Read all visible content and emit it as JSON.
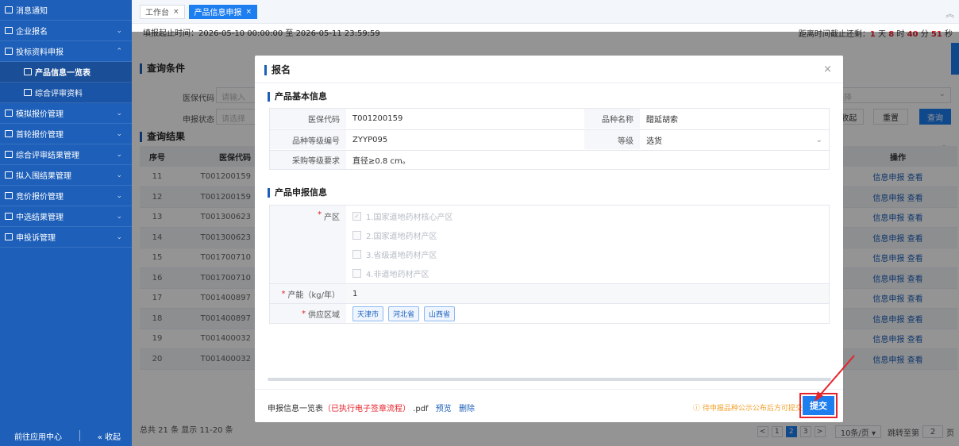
{
  "sidebar": {
    "items": [
      {
        "label": "消息通知",
        "chevron": ""
      },
      {
        "label": "企业报名",
        "chevron": "⌄"
      },
      {
        "label": "投标资料申报",
        "chevron": "⌃"
      },
      {
        "label": "产品信息一览表",
        "chevron": ""
      },
      {
        "label": "综合评审资料",
        "chevron": ""
      },
      {
        "label": "模拟报价管理",
        "chevron": "⌄"
      },
      {
        "label": "首轮报价管理",
        "chevron": "⌄"
      },
      {
        "label": "综合评审结果管理",
        "chevron": "⌄"
      },
      {
        "label": "拟入围结果管理",
        "chevron": "⌄"
      },
      {
        "label": "竞价报价管理",
        "chevron": "⌄"
      },
      {
        "label": "中选结果管理",
        "chevron": "⌄"
      },
      {
        "label": "申投诉管理",
        "chevron": "⌄"
      }
    ],
    "footer_left": "前往应用中心",
    "footer_right": "« 收起"
  },
  "tabs": [
    {
      "label": "工作台",
      "close": "×"
    },
    {
      "label": "产品信息申报",
      "close": "×"
    }
  ],
  "timebar": {
    "text": "填报起止时间：2026-05-10 00:00:00 至 2026-05-11 23:59:59",
    "countdown_prefix": "距离时间截止还剩：",
    "days": "1",
    "days_unit": "天",
    "hours": "8",
    "hours_unit": "时",
    "minutes": "40",
    "minutes_unit": "分",
    "seconds": "51",
    "seconds_unit": "秒"
  },
  "query": {
    "title": "查询条件",
    "code_label": "医保代码",
    "code_placeholder": "请输入",
    "status_label": "申报状态",
    "status_placeholder": "请选择",
    "right_placeholder": "选择",
    "collapse": "∧ 收起",
    "reset": "重置",
    "search": "查询"
  },
  "results": {
    "title": "查询结果",
    "headers": {
      "index": "序号",
      "code": "医保代码",
      "ops": "操作"
    },
    "rows": [
      {
        "index": "11",
        "code": "T001200159"
      },
      {
        "index": "12",
        "code": "T001200159"
      },
      {
        "index": "13",
        "code": "T001300623"
      },
      {
        "index": "14",
        "code": "T001300623"
      },
      {
        "index": "15",
        "code": "T001700710"
      },
      {
        "index": "16",
        "code": "T001700710"
      },
      {
        "index": "17",
        "code": "T001400897"
      },
      {
        "index": "18",
        "code": "T001400897"
      },
      {
        "index": "19",
        "code": "T001400032"
      },
      {
        "index": "20",
        "code": "T001400032"
      }
    ],
    "op1": "信息申报",
    "op2": "查看"
  },
  "footer": {
    "info": "总共 21 条 显示 11-20 条",
    "pages": [
      "1",
      "2",
      "3"
    ],
    "current_page": "2",
    "page_size": "10条/页 ▾",
    "jump_label": "跳转至第",
    "jump_value": "2",
    "jump_unit": "页"
  },
  "modal": {
    "title": "报名",
    "close": "×",
    "basic_title": "产品基本信息",
    "code_label": "医保代码",
    "code_value": "T001200159",
    "name_label": "品种名称",
    "name_value": "醋延胡索",
    "grade_code_label": "品种等级编号",
    "grade_code_value": "ZYYP095",
    "grade_label": "等级",
    "grade_value": "选货",
    "req_label": "采购等级要求",
    "req_value": "直径≥0.8 cm。",
    "decl_title": "产品申报信息",
    "origin_label": "产区",
    "origins": [
      {
        "label": "1.国家道地药材核心产区",
        "checked": true
      },
      {
        "label": "2.国家道地药材产区",
        "checked": false
      },
      {
        "label": "3.省级道地药材产区",
        "checked": false
      },
      {
        "label": "4.非道地药材产区",
        "checked": false
      }
    ],
    "capacity_label": "产能（kg/年）",
    "capacity_value": "1",
    "region_label": "供应区域",
    "regions": [
      "天津市",
      "河北省",
      "山西省"
    ],
    "footer_doc": "申报信息一览表",
    "footer_status": "（已执行电子签章流程）",
    "footer_ext": ".pdf",
    "preview": "预览",
    "delete": "删除",
    "warning": "ⓘ 待申报品种公示公布后方可提交",
    "submit": "提交"
  }
}
